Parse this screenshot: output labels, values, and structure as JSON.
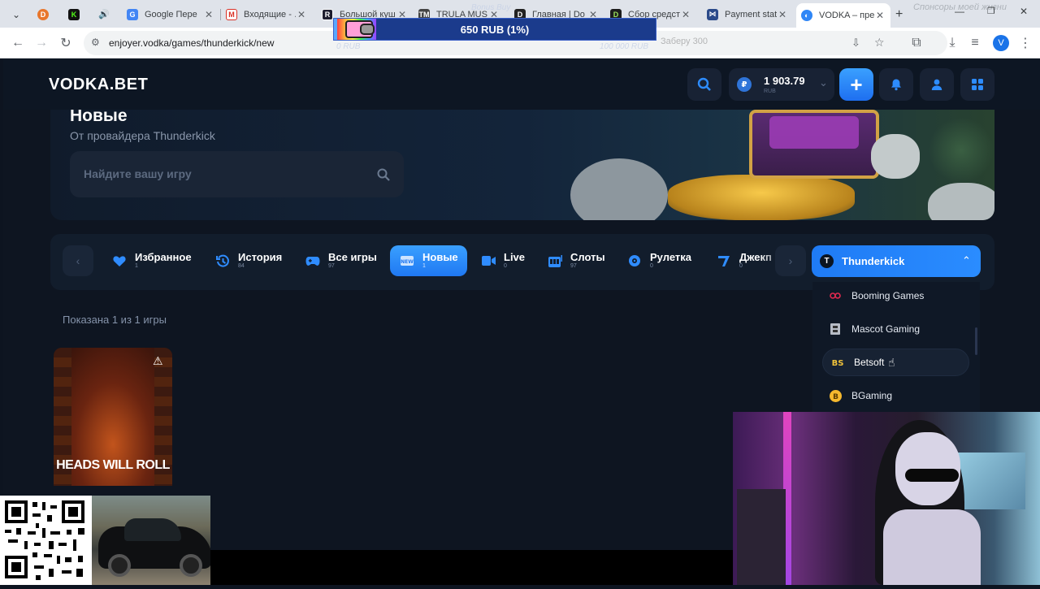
{
  "browser": {
    "tabs": [
      {
        "title": "",
        "icon": "dropdown-icon"
      },
      {
        "title": "",
        "icon": "duckduckgo-icon"
      },
      {
        "title": "",
        "icon": "kick-icon"
      },
      {
        "title": "",
        "icon": "audio-icon"
      },
      {
        "title": "Google Пере",
        "icon": "google-translate-icon"
      },
      {
        "title": "Входящие - …",
        "icon": "gmail-icon"
      },
      {
        "title": "Большой куш",
        "icon": "site-r-icon"
      },
      {
        "title": "TRULA MUS",
        "icon": "site-tm-icon"
      },
      {
        "title": "Главная | Do",
        "icon": "site-d-icon"
      },
      {
        "title": "Сбор средст",
        "icon": "donation-icon"
      },
      {
        "title": "Payment stat",
        "icon": "payment-icon"
      },
      {
        "title": "VODKA – пре",
        "icon": "vodka-icon"
      }
    ],
    "url": "enjoyer.vodka/games/thunderkick/new",
    "profile_initial": "V"
  },
  "stream_overlay": {
    "goal_label": "Bonus Buy",
    "goal_value": "650 RUB (1%)",
    "goal_min": "0 RUB",
    "goal_max": "100 000 RUB",
    "progress": 0.01,
    "sponsor_text": "Спонсоры моей жизни",
    "faded_text": "Заберу 300"
  },
  "header": {
    "logo": "VODKA.BET",
    "balance": "1 903.79",
    "currency": "RUB",
    "currency_symbol": "₽"
  },
  "banner": {
    "title": "Новые",
    "subtitle": "От провайдера Thunderkick",
    "search_placeholder": "Найдите вашу игру"
  },
  "categories": [
    {
      "label": "Избранное",
      "count": "1",
      "icon": "heart-icon"
    },
    {
      "label": "История",
      "count": "84",
      "icon": "history-icon"
    },
    {
      "label": "Все игры",
      "count": "97",
      "icon": "gamepad-icon"
    },
    {
      "label": "Новые",
      "count": "1",
      "icon": "new-icon",
      "active": true
    },
    {
      "label": "Live",
      "count": "0",
      "icon": "live-icon"
    },
    {
      "label": "Слоты",
      "count": "97",
      "icon": "slots-icon"
    },
    {
      "label": "Рулетка",
      "count": "0",
      "icon": "roulette-icon"
    },
    {
      "label": "Джекп",
      "count": "0",
      "icon": "jackpot-icon"
    }
  ],
  "provider": {
    "selected": "Thunderkick",
    "options": [
      "Booming Games",
      "Mascot Gaming",
      "Betsoft",
      "BGaming"
    ],
    "hovered": "Betsoft"
  },
  "results": {
    "shown_text": "Показана 1 из 1 игры"
  },
  "games": [
    {
      "title": "HEADS WILL ROLL"
    }
  ],
  "colors": {
    "accent": "#2a8cff",
    "background": "#0e1521",
    "panel": "#121d2c"
  }
}
